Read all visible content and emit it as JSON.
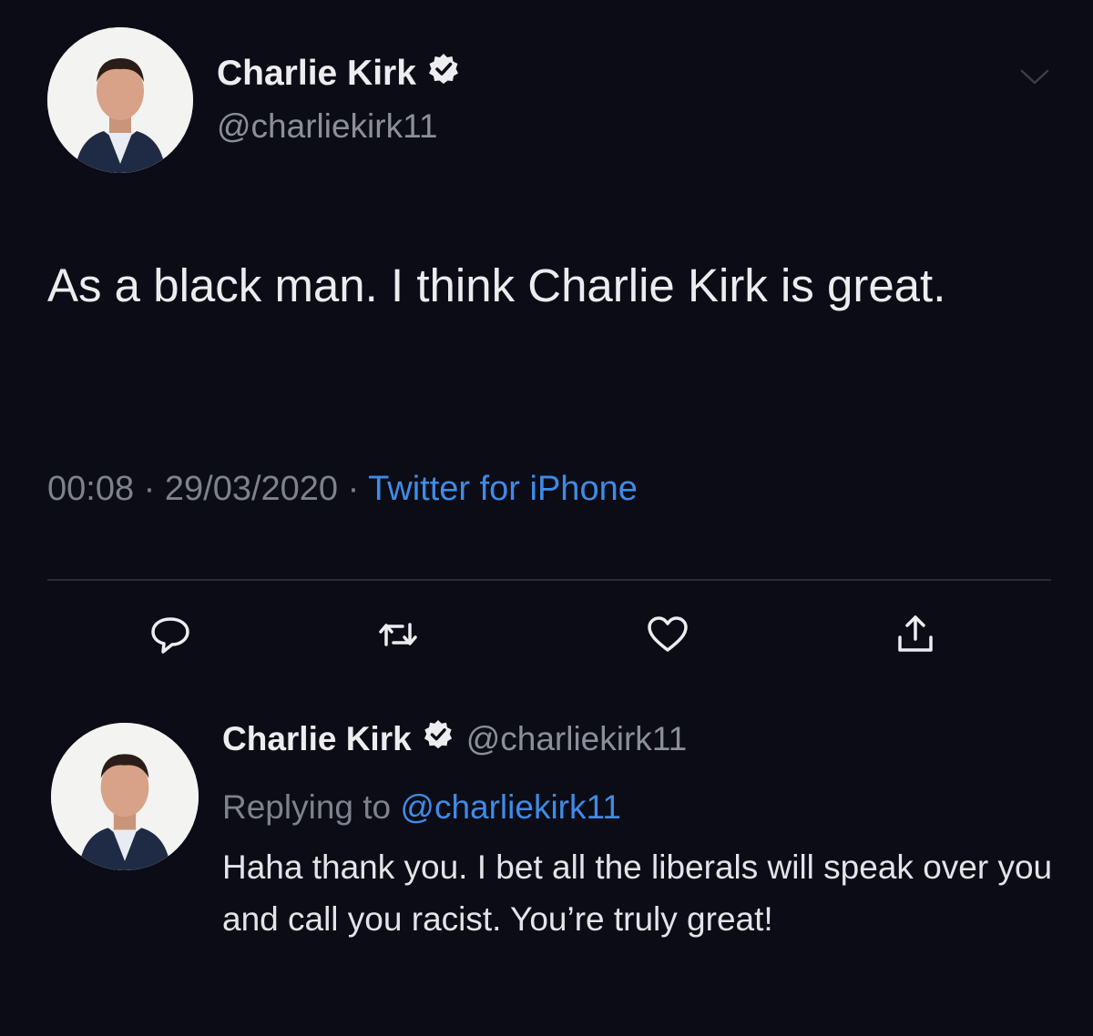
{
  "main_tweet": {
    "author": {
      "display_name": "Charlie Kirk",
      "handle": "@charliekirk11",
      "verified": true,
      "avatar_icon": "avatar-icon"
    },
    "text": "As a black man. I think Charlie Kirk is great.",
    "timestamp": "00:08",
    "separator": "·",
    "date": "29/03/2020",
    "source": "Twitter for iPhone",
    "menu_icon": "chevron-down-icon",
    "actions": [
      {
        "name": "reply",
        "icon": "reply-icon"
      },
      {
        "name": "retweet",
        "icon": "retweet-icon"
      },
      {
        "name": "like",
        "icon": "heart-icon"
      },
      {
        "name": "share",
        "icon": "share-icon"
      }
    ]
  },
  "reply_tweet": {
    "author": {
      "display_name": "Charlie Kirk",
      "handle": "@charliekirk11",
      "verified": true,
      "avatar_icon": "avatar-icon"
    },
    "replying_prefix": "Replying to",
    "replying_to": "@charliekirk11",
    "text": "Haha thank you. I bet all the liberals will speak over you and call you racist. You’re truly great!"
  },
  "colors": {
    "background": "#0b0c16",
    "link_blue": "#3f8be6",
    "secondary_text": "#8b8f99",
    "verified_badge": "#ededf0"
  }
}
